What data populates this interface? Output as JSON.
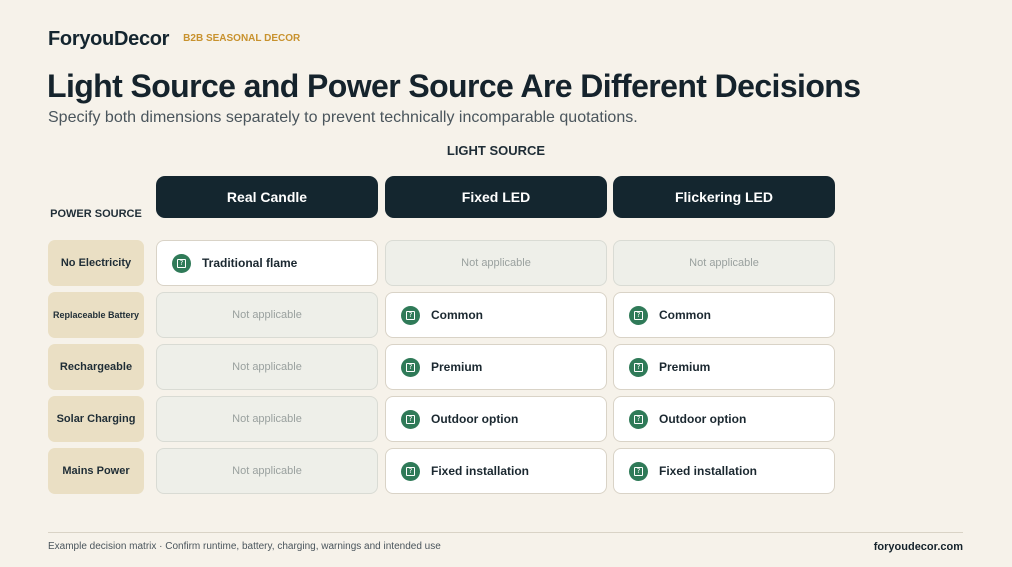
{
  "header": {
    "brand": "ForyouDecor",
    "tag": "B2B SEASONAL DECOR",
    "title": "Light Source and Power Source Are Different Decisions",
    "subtitle": "Specify both dimensions separately to prevent technically incomparable quotations."
  },
  "matrix": {
    "light_axis_label": "LIGHT SOURCE",
    "power_axis_label": "POWER SOURCE",
    "columns": [
      "Real Candle",
      "Fixed LED",
      "Flickering LED"
    ],
    "rows": [
      {
        "label": "No Electricity",
        "cells": [
          {
            "status": "ok",
            "text": "Traditional flame"
          },
          {
            "status": "na",
            "text": "Not applicable"
          },
          {
            "status": "na",
            "text": "Not applicable"
          }
        ]
      },
      {
        "label": "Replaceable Battery",
        "cells": [
          {
            "status": "na",
            "text": "Not applicable"
          },
          {
            "status": "ok",
            "text": "Common"
          },
          {
            "status": "ok",
            "text": "Common"
          }
        ]
      },
      {
        "label": "Rechargeable",
        "cells": [
          {
            "status": "na",
            "text": "Not applicable"
          },
          {
            "status": "ok",
            "text": "Premium"
          },
          {
            "status": "ok",
            "text": "Premium"
          }
        ]
      },
      {
        "label": "Solar Charging",
        "cells": [
          {
            "status": "na",
            "text": "Not applicable"
          },
          {
            "status": "ok",
            "text": "Outdoor option"
          },
          {
            "status": "ok",
            "text": "Outdoor option"
          }
        ]
      },
      {
        "label": "Mains Power",
        "cells": [
          {
            "status": "na",
            "text": "Not applicable"
          },
          {
            "status": "ok",
            "text": "Fixed installation"
          },
          {
            "status": "ok",
            "text": "Fixed installation"
          }
        ]
      }
    ],
    "check_icon": "check-icon",
    "check_glyph": "?"
  },
  "footer": {
    "note": "Example decision matrix · Confirm runtime, battery, charging, warnings and intended use",
    "site": "foryoudecor.com"
  },
  "colors": {
    "background": "#f6f2ea",
    "header_dark": "#14262f",
    "row_label_bg": "#eadfc4",
    "accent_gold": "#c8922e",
    "check_green": "#2f7a58"
  }
}
